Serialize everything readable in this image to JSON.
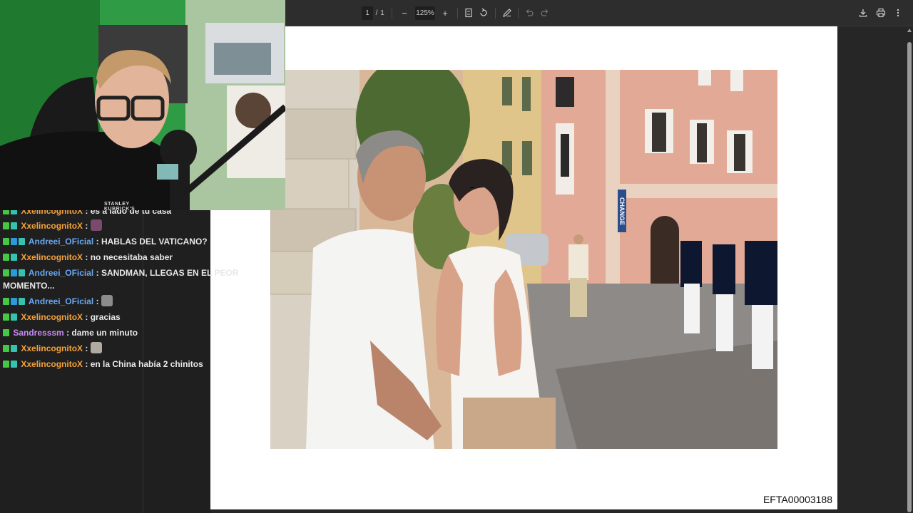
{
  "toolbar": {
    "page_current": "1",
    "page_separator": "/",
    "page_total": "1",
    "zoom_minus": "−",
    "zoom_level": "125%",
    "zoom_plus": "+"
  },
  "document": {
    "code": "EFTA00003188"
  },
  "chat": {
    "messages": [
      {
        "user": "XxelincognitoX",
        "text": ": es a lado de tu casa"
      },
      {
        "user": "XxelincognitoX",
        "text": ":"
      },
      {
        "user": "Andreei_OFicial",
        "text": ": HABLAS DEL VATICANO?"
      },
      {
        "user": "XxelincognitoX",
        "text": ": no necesitaba saber"
      },
      {
        "user": "Andreei_OFicial",
        "text": ": SANDMAN, LLEGAS EN EL PEOR"
      },
      {
        "user": "",
        "text": "MOMENTO..."
      },
      {
        "user": "Andreei_OFicial",
        "text": ":"
      },
      {
        "user": "XxelincognitoX",
        "text": ": gracias"
      },
      {
        "user": "Sandresssm",
        "text": ": dame un minuto"
      },
      {
        "user": "XxelincognitoX",
        "text": ":"
      },
      {
        "user": "XxelincognitoX",
        "text": ": en la China había 2 chinitos"
      }
    ]
  },
  "photo": {
    "sign_text": "CHANGE"
  },
  "webcam": {
    "shirt_text": "STANLEY KUBRICK'S"
  },
  "colors": {
    "chat_bg": "#1f1f1f",
    "toolbar_bg": "#2d2d2d",
    "user_orange": "#f5a23a",
    "user_blue": "#6aa8f0",
    "user_purple": "#c78cf2",
    "badge_green": "#45c945"
  }
}
